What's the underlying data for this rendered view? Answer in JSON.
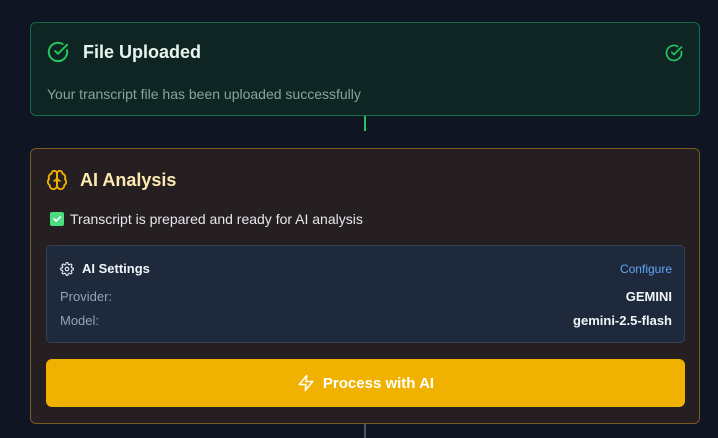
{
  "uploaded": {
    "title": "File Uploaded",
    "description": "Your transcript file has been uploaded successfully",
    "icon": "check-circle-icon",
    "accent": "#22c55e"
  },
  "analysis": {
    "title": "AI Analysis",
    "icon": "brain-icon",
    "accent": "#f0b100",
    "status_text": "Transcript is prepared and ready for AI analysis",
    "settings": {
      "title": "AI Settings",
      "configure_label": "Configure",
      "provider_label": "Provider:",
      "provider_value": "GEMINI",
      "model_label": "Model:",
      "model_value": "gemini-2.5-flash"
    },
    "process_label": "Process with AI"
  }
}
